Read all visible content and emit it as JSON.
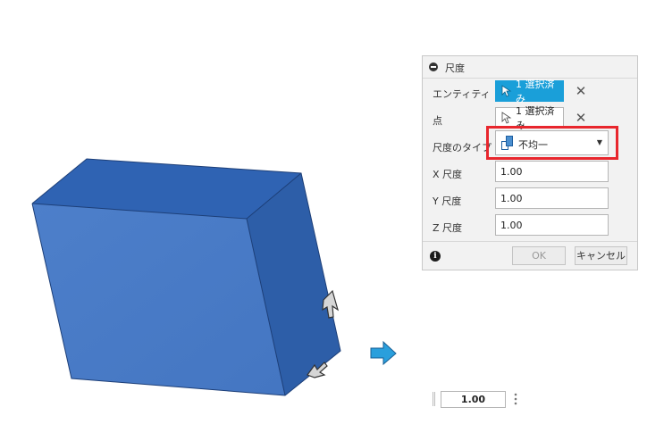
{
  "dialog": {
    "title": "尺度",
    "rows": {
      "entity": {
        "label": "エンティティ",
        "value": "1 選択済み"
      },
      "point": {
        "label": "点",
        "value": "1 選択済み"
      },
      "scale_type": {
        "label": "尺度のタイプ",
        "value": "不均一"
      },
      "x_scale": {
        "label": "X 尺度",
        "value": "1.00"
      },
      "y_scale": {
        "label": "Y 尺度",
        "value": "1.00"
      },
      "z_scale": {
        "label": "Z 尺度",
        "value": "1.00"
      }
    },
    "ok_label": "OK",
    "cancel_label": "キャンセル"
  },
  "floating_input": {
    "value": "1.00"
  },
  "colors": {
    "accent": "#1a9fd9",
    "highlight": "#e8262d",
    "body_front": "#4a7bc6",
    "body_top": "#2f63b3",
    "body_side": "#2d5ea8"
  }
}
